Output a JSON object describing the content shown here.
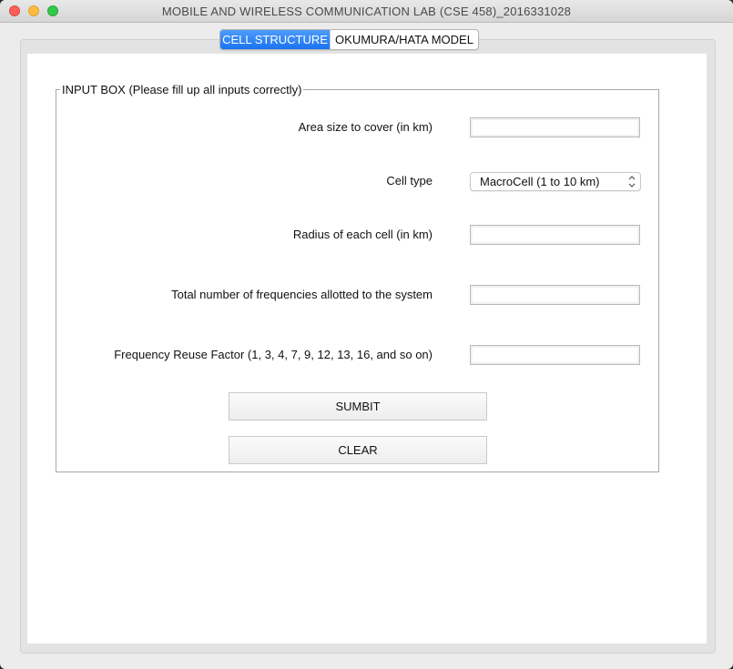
{
  "window": {
    "title": "MOBILE AND WIRELESS COMMUNICATION LAB (CSE 458)_2016331028"
  },
  "tabs": [
    {
      "label": "CELL STRUCTURE",
      "active": true
    },
    {
      "label": "OKUMURA/HATA MODEL",
      "active": false
    }
  ],
  "input_box": {
    "legend": "INPUT BOX (Please fill up all inputs correctly)",
    "fields": {
      "area": {
        "label": "Area size to cover (in km)",
        "value": ""
      },
      "cell_type": {
        "label": "Cell type",
        "selected": "MacroCell (1 to 10 km)"
      },
      "radius": {
        "label": "Radius of each cell (in km)",
        "value": ""
      },
      "frequencies": {
        "label": "Total number of frequencies allotted to the system",
        "value": ""
      },
      "reuse": {
        "label": "Frequency Reuse Factor (1, 3, 4, 7, 9, 12, 13, 16, and so on)",
        "value": ""
      }
    },
    "buttons": {
      "submit": "SUMBIT",
      "clear": "CLEAR"
    }
  },
  "colors": {
    "active_tab": "#1a73f0",
    "close": "#fc605c",
    "minimize": "#fdbc40",
    "maximize": "#34c84a"
  }
}
